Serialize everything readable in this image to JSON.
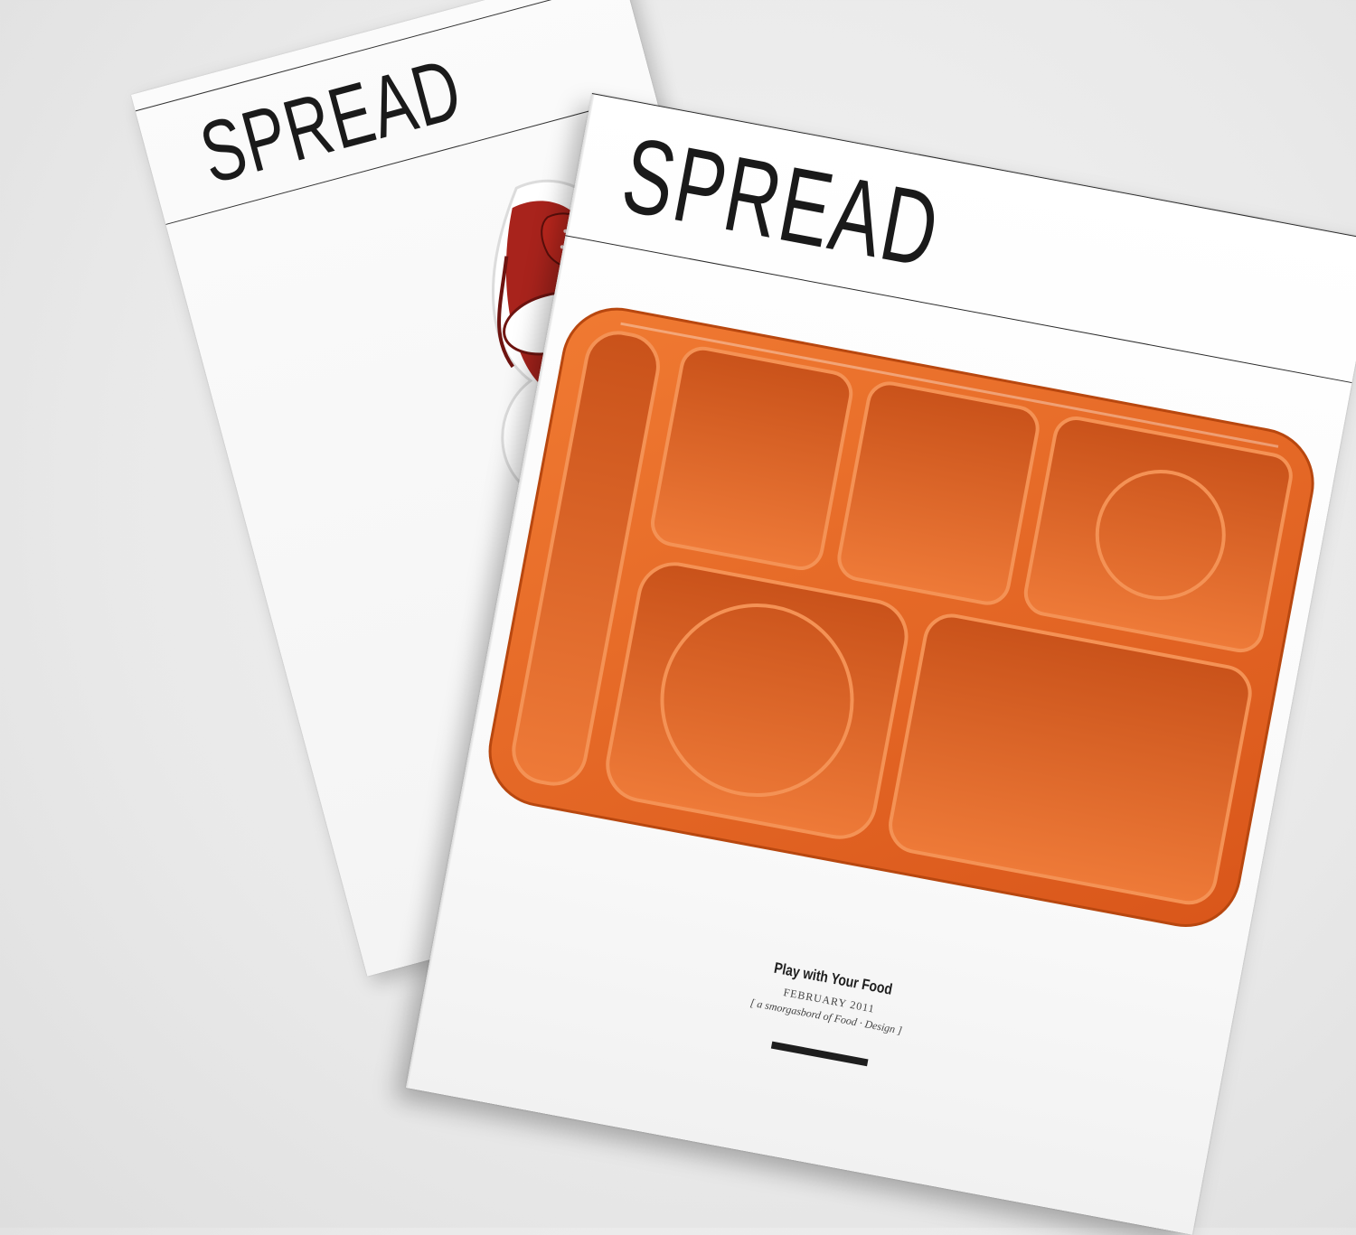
{
  "colors": {
    "tray": "#e8651f",
    "sauce": "#a8231c",
    "dish_outline": "#5b72b8",
    "ink": "#1a1a1a"
  },
  "back_magazine": {
    "title": "SPREAD",
    "cover_art": "strawberry-sundae-illustration"
  },
  "front_magazine": {
    "title": "SPREAD",
    "cover_art": "orange-lunch-tray-photo",
    "headline": "Play with Your Food",
    "issue_date": "FEBRUARY 2011",
    "tagline": "[ a smorgasbord of Food · Design ]"
  }
}
